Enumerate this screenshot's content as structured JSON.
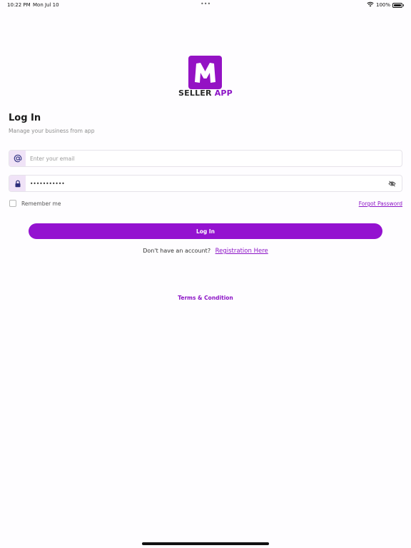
{
  "status_bar": {
    "time": "10:22 PM",
    "date": "Mon Jul 10",
    "battery": "100%"
  },
  "brand": {
    "logo_letter": "M",
    "name_part1": "SELLER",
    "name_part2": "APP",
    "accent_color": "#9412c4"
  },
  "login": {
    "title": "Log In",
    "subtitle": "Manage your business from app",
    "email_placeholder": "Enter your email",
    "password_value": "•••••••••••",
    "remember_label": "Remember me",
    "forgot_label": "Forgot Password",
    "button_label": "Log In",
    "no_account_text": "Don't have an account?",
    "register_label": "Registration Here",
    "terms_label": "Terms & Condition"
  },
  "icons": {
    "email": "at-icon",
    "password": "lock-icon",
    "visibility": "eye-off-icon",
    "wifi": "wifi-icon",
    "battery": "battery-icon"
  }
}
